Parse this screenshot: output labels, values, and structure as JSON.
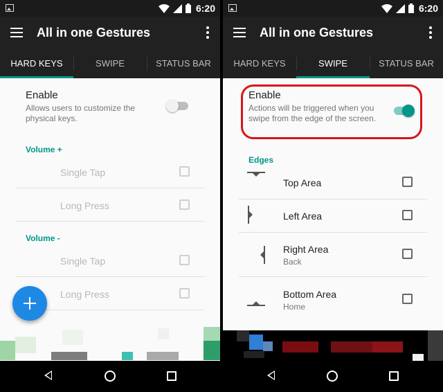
{
  "status_bar": {
    "time": "6:20",
    "network_badge": "R"
  },
  "app_bar": {
    "title": "All in one Gestures"
  },
  "tabs": [
    "HARD KEYS",
    "SWIPE",
    "STATUS BAR"
  ],
  "hard_keys_screen": {
    "enable": {
      "title": "Enable",
      "description": "Allows users to customize the physical keys.",
      "toggled": false
    },
    "sections": [
      {
        "header": "Volume +",
        "rows": [
          "Single Tap",
          "Long Press"
        ]
      },
      {
        "header": "Volume -",
        "rows": [
          "Single Tap",
          "Long Press"
        ]
      }
    ],
    "fab_icon": "add-icon"
  },
  "swipe_screen": {
    "enable": {
      "title": "Enable",
      "description": "Actions will be triggered when you swipe from the edge of the screen.",
      "toggled": true
    },
    "section_header": "Edges",
    "edges": [
      {
        "label": "Top Area",
        "sub": "",
        "icon": "top-edge-icon"
      },
      {
        "label": "Left Area",
        "sub": "",
        "icon": "left-edge-icon"
      },
      {
        "label": "Right Area",
        "sub": "Back",
        "icon": "right-edge-icon"
      },
      {
        "label": "Bottom Area",
        "sub": "Home",
        "icon": "bottom-edge-icon"
      }
    ]
  },
  "colors": {
    "accent": "#009688",
    "fab": "#1e88e5",
    "highlight": "#d7141a",
    "app_bar": "#212121"
  }
}
